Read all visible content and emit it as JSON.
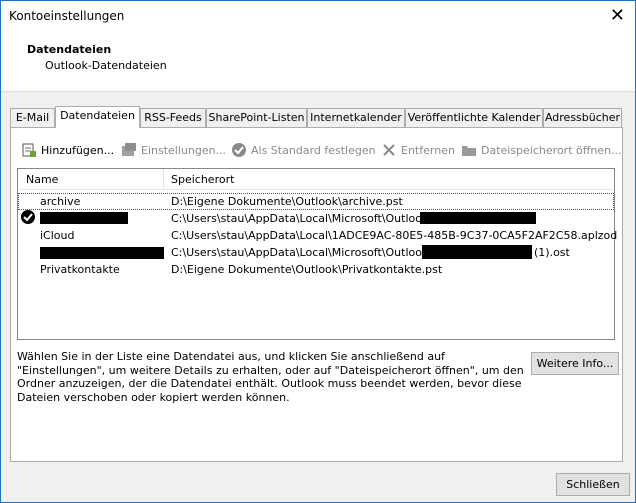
{
  "window": {
    "title": "Kontoeinstellungen"
  },
  "header": {
    "title": "Datendateien",
    "subtitle": "Outlook-Datendateien"
  },
  "tabs": [
    {
      "label": "E-Mail"
    },
    {
      "label": "Datendateien"
    },
    {
      "label": "RSS-Feeds"
    },
    {
      "label": "SharePoint-Listen"
    },
    {
      "label": "Internetkalender"
    },
    {
      "label": "Veröffentlichte Kalender"
    },
    {
      "label": "Adressbücher"
    }
  ],
  "toolbar": {
    "add": "Hinzufügen...",
    "settings": "Einstellungen...",
    "set_default": "Als Standard festlegen",
    "remove": "Entfernen",
    "open_location": "Dateispeicherort öffnen..."
  },
  "list": {
    "columns": {
      "name": "Name",
      "location": "Speicherort"
    },
    "rows": [
      {
        "name": "archive",
        "location": "D:\\Eigene Dokumente\\Outlook\\archive.pst"
      },
      {
        "name": "",
        "location": "C:\\Users\\stau\\AppData\\Local\\Microsoft\\Outlook\\"
      },
      {
        "name": "iCloud",
        "location": "C:\\Users\\stau\\AppData\\Local\\1ADCE9AC-80E5-485B-9C37-0CA5F2AF2C58.aplzod"
      },
      {
        "name": "",
        "location": "C:\\Users\\stau\\AppData\\Local\\Microsoft\\Outlook\\",
        "suffix": "(1).ost"
      },
      {
        "name": "Privatkontakte",
        "location": "D:\\Eigene Dokumente\\Outlook\\Privatkontakte.pst"
      }
    ]
  },
  "description": "Wählen Sie in der Liste eine Datendatei aus, und klicken Sie anschließend auf \"Einstellungen\", um weitere Details zu erhalten, oder auf \"Dateispeicherort öffnen\", um den Ordner anzuzeigen, der die Datendatei enthält. Outlook muss beendet werden, bevor diese Dateien verschoben oder kopiert werden können.",
  "buttons": {
    "more_info": "Weitere Info...",
    "close": "Schließen"
  }
}
